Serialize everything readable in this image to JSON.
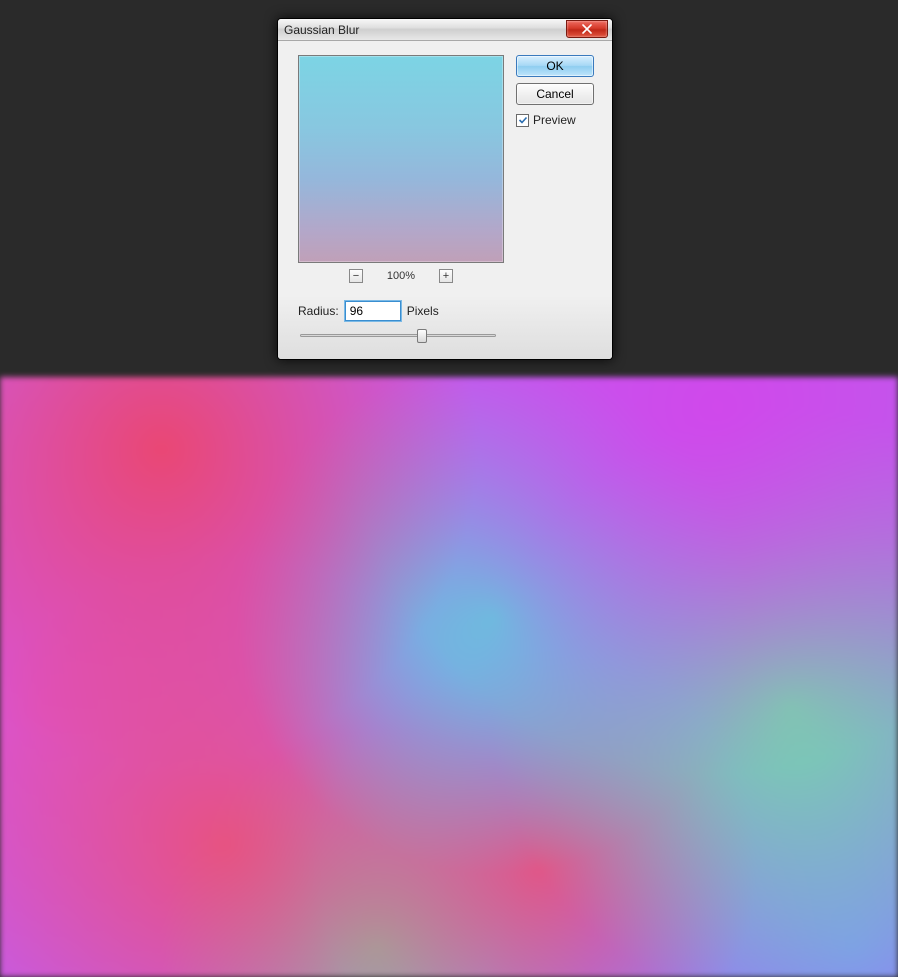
{
  "dialog": {
    "title": "Gaussian Blur",
    "ok_label": "OK",
    "cancel_label": "Cancel",
    "preview_label": "Preview",
    "preview_checked": true,
    "zoom": {
      "minus_glyph": "−",
      "plus_glyph": "+",
      "level": "100%"
    },
    "radius": {
      "label": "Radius:",
      "value": "96",
      "unit": "Pixels"
    }
  }
}
